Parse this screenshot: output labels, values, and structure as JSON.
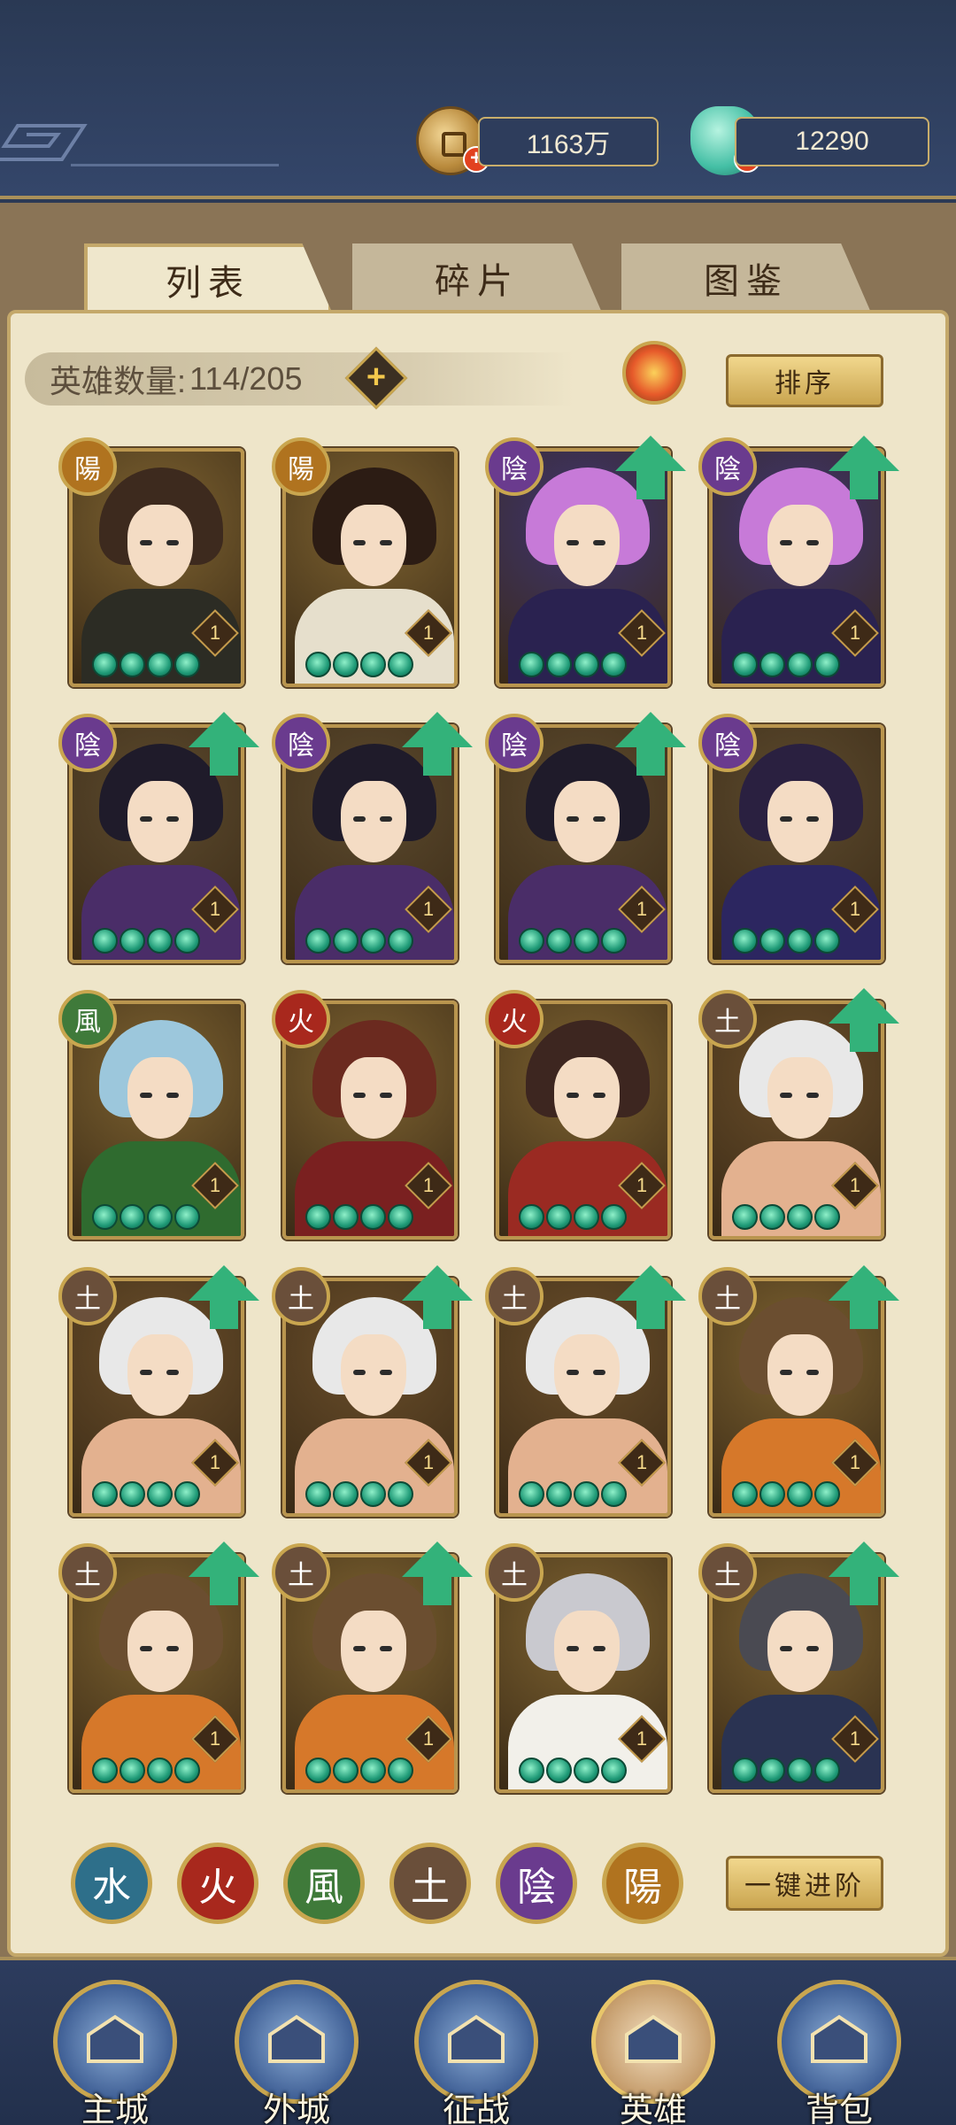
{
  "resources": {
    "coins": "1163万",
    "jade": "12290"
  },
  "tabs": [
    {
      "label": "列表",
      "active": true
    },
    {
      "label": "碎片",
      "active": false
    },
    {
      "label": "图鉴",
      "active": false
    }
  ],
  "hero_count": {
    "label": "英雄数量:",
    "value": "114/205"
  },
  "sort_label": "排序",
  "advance_label": "一键进阶",
  "element_glyphs": {
    "yang": "陽",
    "yin": "陰",
    "wind": "風",
    "fire": "火",
    "earth": "土",
    "water": "水"
  },
  "heroes": [
    {
      "element": "yang",
      "level": "1",
      "upgrade": false,
      "palette": "olive-black"
    },
    {
      "element": "yang",
      "level": "1",
      "upgrade": false,
      "palette": "ivory-dark"
    },
    {
      "element": "yin",
      "level": "1",
      "upgrade": true,
      "palette": "pink-purple"
    },
    {
      "element": "yin",
      "level": "1",
      "upgrade": true,
      "palette": "pink-purple"
    },
    {
      "element": "yin",
      "level": "1",
      "upgrade": true,
      "palette": "black-purple"
    },
    {
      "element": "yin",
      "level": "1",
      "upgrade": true,
      "palette": "black-purple"
    },
    {
      "element": "yin",
      "level": "1",
      "upgrade": true,
      "palette": "black-purple"
    },
    {
      "element": "yin",
      "level": "1",
      "upgrade": false,
      "palette": "white-navy"
    },
    {
      "element": "wind",
      "level": "1",
      "upgrade": false,
      "palette": "blue-green"
    },
    {
      "element": "fire",
      "level": "1",
      "upgrade": false,
      "palette": "red-brown"
    },
    {
      "element": "fire",
      "level": "1",
      "upgrade": false,
      "palette": "brown-red"
    },
    {
      "element": "earth",
      "level": "1",
      "upgrade": true,
      "palette": "white-skin"
    },
    {
      "element": "earth",
      "level": "1",
      "upgrade": true,
      "palette": "white-skin"
    },
    {
      "element": "earth",
      "level": "1",
      "upgrade": true,
      "palette": "white-skin"
    },
    {
      "element": "earth",
      "level": "1",
      "upgrade": true,
      "palette": "white-skin"
    },
    {
      "element": "earth",
      "level": "1",
      "upgrade": true,
      "palette": "brown-orange"
    },
    {
      "element": "earth",
      "level": "1",
      "upgrade": true,
      "palette": "brown-orange"
    },
    {
      "element": "earth",
      "level": "1",
      "upgrade": true,
      "palette": "brown-orange"
    },
    {
      "element": "earth",
      "level": "1",
      "upgrade": false,
      "palette": "grey-white"
    },
    {
      "element": "earth",
      "level": "1",
      "upgrade": true,
      "palette": "grey-navy"
    }
  ],
  "element_filters": [
    "water",
    "fire",
    "wind",
    "earth",
    "yin",
    "yang"
  ],
  "nav": [
    {
      "label": "主城",
      "icon": "palace-icon"
    },
    {
      "label": "外城",
      "icon": "city-gate-icon"
    },
    {
      "label": "征战",
      "icon": "war-horn-icon"
    },
    {
      "label": "英雄",
      "icon": "hero-portrait-icon"
    },
    {
      "label": "背包",
      "icon": "bag-icon"
    }
  ],
  "colors": {
    "navy": "#2c3a55",
    "gold": "#c9a64f",
    "panel": "#eee5c9",
    "jade_green": "#33b27a"
  }
}
